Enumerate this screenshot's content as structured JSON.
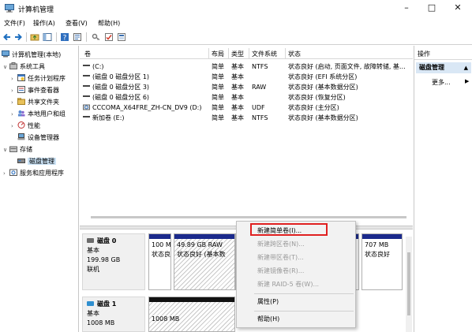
{
  "window": {
    "title": "计算机管理",
    "minimize": "–",
    "maximize": "□",
    "close": "✕"
  },
  "menu": [
    "文件(F)",
    "操作(A)",
    "查看(V)",
    "帮助(H)"
  ],
  "toolbar_icons": [
    "back-icon",
    "forward-icon",
    "up-folder-icon",
    "console-tree-icon",
    "help-icon",
    "properties-icon",
    "key-icon",
    "check-icon",
    "export-icon"
  ],
  "tree": [
    {
      "label": "计算机管理(本地)",
      "chevron": "",
      "icon": "computer-icon"
    },
    {
      "label": "系统工具",
      "chevron": "∨",
      "icon": "tools-icon"
    },
    {
      "label": "任务计划程序",
      "chevron": "›",
      "icon": "scheduler-icon"
    },
    {
      "label": "事件查看器",
      "chevron": "›",
      "icon": "event-viewer-icon"
    },
    {
      "label": "共享文件夹",
      "chevron": "›",
      "icon": "shared-folder-icon"
    },
    {
      "label": "本地用户和组",
      "chevron": "›",
      "icon": "users-icon"
    },
    {
      "label": "性能",
      "chevron": "›",
      "icon": "performance-icon"
    },
    {
      "label": "设备管理器",
      "chevron": "",
      "icon": "device-manager-icon"
    },
    {
      "label": "存储",
      "chevron": "∨",
      "icon": "storage-icon"
    },
    {
      "label": "磁盘管理",
      "chevron": "",
      "icon": "disk-management-icon"
    },
    {
      "label": "服务和应用程序",
      "chevron": "›",
      "icon": "services-icon"
    }
  ],
  "volume_columns": [
    "卷",
    "布局",
    "类型",
    "文件系统",
    "状态"
  ],
  "volumes": [
    {
      "name": "(C:)",
      "layout": "简单",
      "type": "基本",
      "fs": "NTFS",
      "status": "状态良好 (启动, 页面文件, 故障转储, 基…"
    },
    {
      "name": "(磁盘 0 磁盘分区 1)",
      "layout": "简单",
      "type": "基本",
      "fs": "",
      "status": "状态良好 (EFI 系统分区)"
    },
    {
      "name": "(磁盘 0 磁盘分区 3)",
      "layout": "简单",
      "type": "基本",
      "fs": "RAW",
      "status": "状态良好 (基本数据分区)"
    },
    {
      "name": "(磁盘 0 磁盘分区 6)",
      "layout": "简单",
      "type": "基本",
      "fs": "",
      "status": "状态良好 (恢复分区)"
    },
    {
      "name": "CCCOMA_X64FRE_ZH-CN_DV9 (D:)",
      "layout": "简单",
      "type": "基本",
      "fs": "UDF",
      "status": "状态良好 (主分区)"
    },
    {
      "name": "新加卷 (E:)",
      "layout": "简单",
      "type": "基本",
      "fs": "NTFS",
      "status": "状态良好 (基本数据分区)"
    }
  ],
  "disks": [
    {
      "name": "磁盘 0",
      "kind": "基本",
      "size": "199.98 GB",
      "state": "联机",
      "partitions": [
        {
          "line1": "100 M",
          "line2": "状态良"
        },
        {
          "line1": "49.89 GB RAW",
          "line2": "状态良好 (基本数"
        },
        {
          "line1": "707 MB",
          "line2": "状态良好"
        }
      ]
    },
    {
      "name": "磁盘 1",
      "kind": "基本",
      "size": "1008 MB",
      "partitions": [
        {
          "line1": "1008 MB",
          "line2": ""
        }
      ]
    }
  ],
  "actions": {
    "header": "操作",
    "section": "磁盘管理",
    "more": "更多..."
  },
  "context_menu": {
    "items": [
      {
        "label": "新建简单卷(I)...",
        "enabled": true
      },
      {
        "label": "新建跨区卷(N)...",
        "enabled": false
      },
      {
        "label": "新建带区卷(T)...",
        "enabled": false
      },
      {
        "label": "新建镜像卷(R)...",
        "enabled": false
      },
      {
        "label": "新建 RAID-5 卷(W)...",
        "enabled": false
      },
      {
        "label": "属性(P)",
        "enabled": true
      },
      {
        "label": "帮助(H)",
        "enabled": true
      }
    ],
    "highlight_color": "#e02020"
  },
  "colors": {
    "partition_bar": "#1b2a8c",
    "selection": "#cce4f7",
    "action_highlight": "#d9e7f5"
  }
}
